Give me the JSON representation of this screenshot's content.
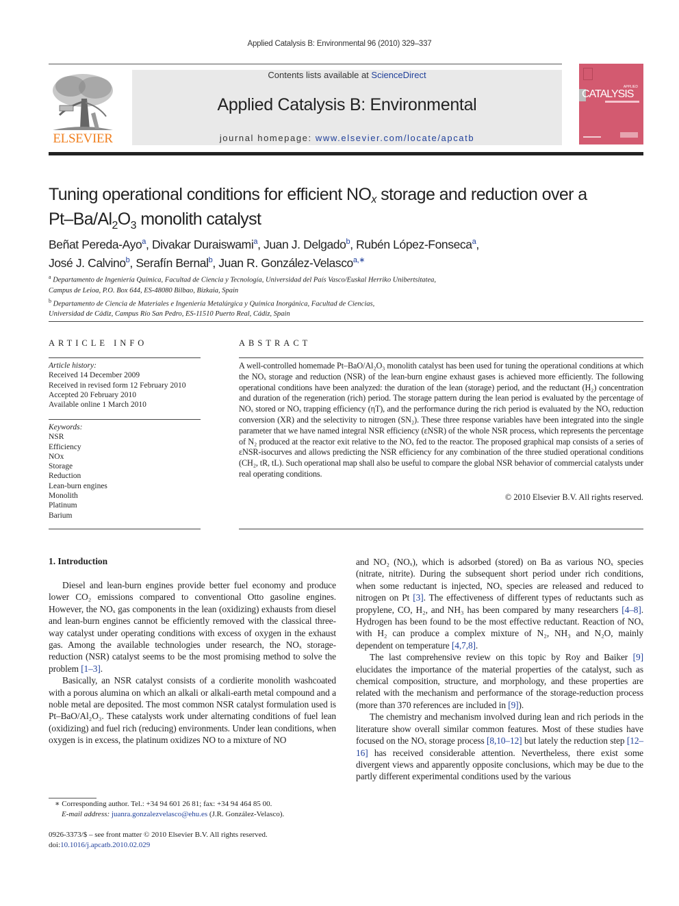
{
  "running_head": "Applied Catalysis B: Environmental 96 (2010) 329–337",
  "header": {
    "publisher_logo_text": "ELSEVIER",
    "contents_prefix": "Contents lists available at ",
    "contents_link": "ScienceDirect",
    "journal_title": "Applied Catalysis B: Environmental",
    "homepage_prefix": "journal homepage: ",
    "homepage_url": "www.elsevier.com/locate/apcatb",
    "cover": {
      "small_label": "APPLIED",
      "title": "CATALYSIS",
      "colors": {
        "cover": "#d35a70",
        "logo_orange": "#f07f1e",
        "link_blue": "#1f3f9a"
      }
    }
  },
  "article": {
    "title_part1": "Tuning operational conditions for efficient NO",
    "title_x": "x",
    "title_part2": " storage and reduction over a",
    "title_line2_a": "Pt–Ba/Al",
    "title_line2_sub2": "2",
    "title_line2_b": "O",
    "title_line2_sub3": "3",
    "title_line2_c": " monolith catalyst",
    "authors": [
      {
        "name": "Beñat Pereda-Ayo",
        "aff": "a",
        "sep": ", "
      },
      {
        "name": "Divakar Duraiswami",
        "aff": "a",
        "sep": ", "
      },
      {
        "name": "Juan J. Delgado",
        "aff": "b",
        "sep": ", "
      },
      {
        "name": "Rubén López-Fonseca",
        "aff": "a",
        "sep": ","
      },
      {
        "name": "José J. Calvino",
        "aff": "b",
        "sep": ", "
      },
      {
        "name": "Serafín Bernal",
        "aff": "b",
        "sep": ", "
      },
      {
        "name": "Juan R. González-Velasco",
        "aff": "a,∗",
        "sep": ""
      }
    ],
    "affiliations": [
      {
        "mark": "a",
        "line1": "Departamento de Ingeniería Química, Facultad de Ciencia y Tecnología, Universidad del País Vasco/Euskal Herriko Unibertsitatea,",
        "line2": "Campus de Leioa, P.O. Box 644, ES-48080 Bilbao, Bizkaia, Spain"
      },
      {
        "mark": "b",
        "line1": "Departamento de Ciencia de Materiales e Ingeniería Metalúrgica y Química Inorgánica, Facultad de Ciencias,",
        "line2": "Universidad de Cádiz, Campus Río San Pedro, ES-11510 Puerto Real, Cádiz, Spain"
      }
    ]
  },
  "article_info": {
    "heading": "ARTICLE INFO",
    "history_label": "Article history:",
    "history": [
      "Received 14 December 2009",
      "Received in revised form 12 February 2010",
      "Accepted 20 February 2010",
      "Available online 1 March 2010"
    ],
    "keywords_label": "Keywords:",
    "keywords": [
      "NSR",
      "Efficiency",
      "NOx",
      "Storage",
      "Reduction",
      "Lean-burn engines",
      "Monolith",
      "Platinum",
      "Barium"
    ]
  },
  "abstract": {
    "heading": "ABSTRACT",
    "text": "A well-controlled homemade Pt–BaO/Al₂O₃ monolith catalyst has been used for tuning the operational conditions at which the NOₓ storage and reduction (NSR) of the lean-burn engine exhaust gases is achieved more efficiently. The following operational conditions have been analyzed: the duration of the lean (storage) period, and the reductant (H₂) concentration and duration of the regeneration (rich) period. The storage pattern during the lean period is evaluated by the percentage of NOₓ stored or NOₓ trapping efficiency (ηT), and the performance during the rich period is evaluated by the NOₓ reduction conversion (XR) and the selectivity to nitrogen (SN₂). These three response variables have been integrated into the single parameter that we have named integral NSR efficiency (εNSR) of the whole NSR process, which represents the percentage of N₂ produced at the reactor exit relative to the NOₓ fed to the reactor. The proposed graphical map consists of a series of εNSR-isocurves and allows predicting the NSR efficiency for any combination of the three studied operational conditions (CH₂, tR, tL). Such operational map shall also be useful to compare the global NSR behavior of commercial catalysts under real operating conditions.",
    "copyright": "© 2010 Elsevier B.V. All rights reserved."
  },
  "body": {
    "intro_heading": "1.  Introduction",
    "left_paragraphs": [
      [
        {
          "t": "Diesel and lean-burn engines provide better fuel economy and produce lower CO₂ emissions compared to conventional Otto gasoline engines. However, the NOₓ gas components in the lean (oxidizing) exhausts from diesel and lean-burn engines cannot be efficiently removed with the classical three-way catalyst under operating conditions with excess of oxygen in the exhaust gas. Among the available technologies under research, the NOₓ storage-reduction (NSR) catalyst seems to be the most promising method to solve the problem "
        },
        {
          "t": "[1–3]",
          "cite": true
        },
        {
          "t": "."
        }
      ],
      [
        {
          "t": "Basically, an NSR catalyst consists of a cordierite monolith washcoated with a porous alumina on which an alkali or alkali-earth metal compound and a noble metal are deposited. The most common NSR catalyst formulation used is Pt–BaO/Al₂O₃. These catalysts work under alternating conditions of fuel lean (oxidizing) and fuel rich (reducing) environments. Under lean conditions, when oxygen is in excess, the platinum oxidizes NO to a mixture of NO"
        }
      ]
    ],
    "right_paragraphs": [
      [
        {
          "t": "and NO₂ (NOₓ), which is adsorbed (stored) on Ba as various NOₓ species (nitrate, nitrite). During the subsequent short period under rich conditions, when some reductant is injected, NOₓ species are released and reduced to nitrogen on Pt "
        },
        {
          "t": "[3]",
          "cite": true
        },
        {
          "t": ". The effectiveness of different types of reductants such as propylene, CO, H₂, and NH₃ has been compared by many researchers "
        },
        {
          "t": "[4–8]",
          "cite": true
        },
        {
          "t": ". Hydrogen has been found to be the most effective reductant. Reaction of NOₓ with H₂ can produce a complex mixture of N₂, NH₃ and N₂O, mainly dependent on temperature "
        },
        {
          "t": "[4,7,8]",
          "cite": true
        },
        {
          "t": "."
        }
      ],
      [
        {
          "t": "The last comprehensive review on this topic by Roy and Baiker "
        },
        {
          "t": "[9]",
          "cite": true
        },
        {
          "t": " elucidates the importance of the material properties of the catalyst, such as chemical composition, structure, and morphology, and these properties are related with the mechanism and performance of the storage-reduction process (more than 370 references are included in "
        },
        {
          "t": "[9]",
          "cite": true
        },
        {
          "t": ")."
        }
      ],
      [
        {
          "t": "The chemistry and mechanism involved during lean and rich periods in the literature show overall similar common features. Most of these studies have focused on the NOₓ storage process "
        },
        {
          "t": "[8,10–12]",
          "cite": true
        },
        {
          "t": " but lately the reduction step "
        },
        {
          "t": "[12–16]",
          "cite": true
        },
        {
          "t": " has received considerable attention. Nevertheless, there exist some divergent views and apparently opposite conclusions, which may be due to the partly different experimental conditions used by the various"
        }
      ]
    ]
  },
  "footnote": {
    "mark": "∗",
    "corresponding": " Corresponding author. Tel.: +34 94 601 26 81; fax: +34 94 464 85 00.",
    "email_label": "E-mail address: ",
    "email": "juanra.gonzalezvelasco@ehu.es",
    "email_suffix": " (J.R. González-Velasco)."
  },
  "front_matter": {
    "issn_line": "0926-3373/$ – see front matter © 2010 Elsevier B.V. All rights reserved.",
    "doi_prefix": "doi:",
    "doi": "10.1016/j.apcatb.2010.02.029"
  }
}
